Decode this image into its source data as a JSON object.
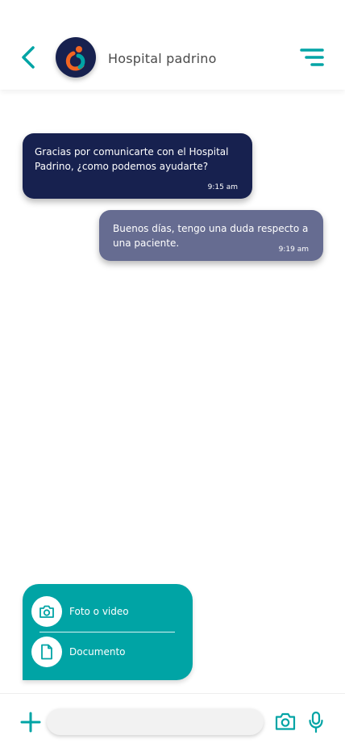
{
  "theme": {
    "accent": "#00a4a5",
    "navy": "#17214f",
    "outgoing": "#666c91"
  },
  "header": {
    "contact_name": "Hospital padrino",
    "back_icon": "chevron-left-icon",
    "menu_icon": "menu-icon"
  },
  "messages": [
    {
      "direction": "incoming",
      "text": "Gracias por comunicarte con el Hospital Padrino, ¿como podemos ayudarte?",
      "time": "9:15 am"
    },
    {
      "direction": "outgoing",
      "text": "Buenos días, tengo una duda respecto a una paciente.",
      "time": "9:19 am"
    }
  ],
  "attach_menu": {
    "items": [
      {
        "label": "Foto o video",
        "icon": "camera-icon"
      },
      {
        "label": "Documento",
        "icon": "document-icon"
      }
    ]
  },
  "composer": {
    "input_value": "",
    "input_placeholder": ""
  }
}
